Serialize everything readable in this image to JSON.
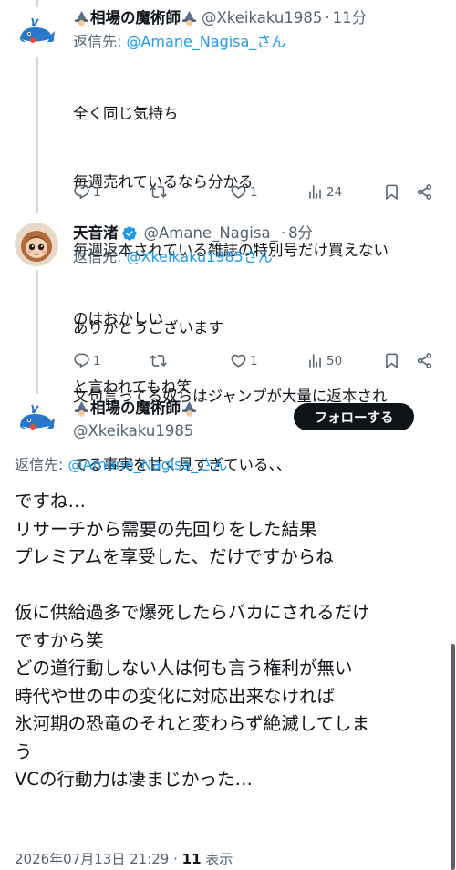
{
  "tweets": [
    {
      "display_name": "相場の魔術師",
      "handle": "@Xkeikaku1985",
      "time": "11分",
      "reply_prefix": "返信先: ",
      "reply_target": "@Amane_Nagisa_さん",
      "lines": [
        "全く同じ気持ち",
        "毎週売れているなら分かる",
        "毎週返本されている雑誌の特別号だけ買えない",
        "のはおかしい",
        "と言われてもね笑"
      ],
      "replies": "1",
      "retweets": "",
      "likes": "1",
      "views": "24"
    },
    {
      "display_name": "天音渚",
      "handle": "@Amane_Nagisa_",
      "time": "8分",
      "reply_prefix": "返信先: ",
      "reply_target": "@Xkeikaku1985さん",
      "lines": [
        "ありがとうございます",
        "文句言ってる奴らはジャンプが大量に返本され",
        "てる事実を甘く見すぎている、、"
      ],
      "replies": "1",
      "retweets": "",
      "likes": "1",
      "views": "50"
    }
  ],
  "main_tweet": {
    "display_name": "相場の魔術師",
    "handle": "@Xkeikaku1985",
    "follow_label": "フォローする",
    "reply_prefix": "返信先: ",
    "reply_target": "@Amane_Nagisa_さん",
    "lines": [
      "ですね…",
      "リサーチから需要の先回りをした結果",
      "プレミアムを享受した、だけですからね",
      "",
      "仮に供給過多で爆死したらバカにされるだけ",
      "ですから笑",
      "どの道行動しない人は何も言う権利が無い",
      "時代や世の中の変化に対応出来なければ",
      "氷河期の恐竜のそれと変わらず絶滅してしま",
      "う",
      "VCの行動力は凄まじかった…"
    ],
    "timestamp": "2026年07月13日 21:29 · ",
    "views_count": "11",
    "views_label": " 表示"
  },
  "icons": [
    "whale-avatar",
    "girl-avatar",
    "wizard-emoji",
    "verified-badge",
    "reply-icon",
    "retweet-icon",
    "like-icon",
    "views-icon",
    "bookmark-icon",
    "share-icon"
  ],
  "colors": {
    "link": "#1d9bf0",
    "secondary": "#536471",
    "text": "#0f1419",
    "verified": "#1d9bf0",
    "button_bg": "#0f1419"
  }
}
